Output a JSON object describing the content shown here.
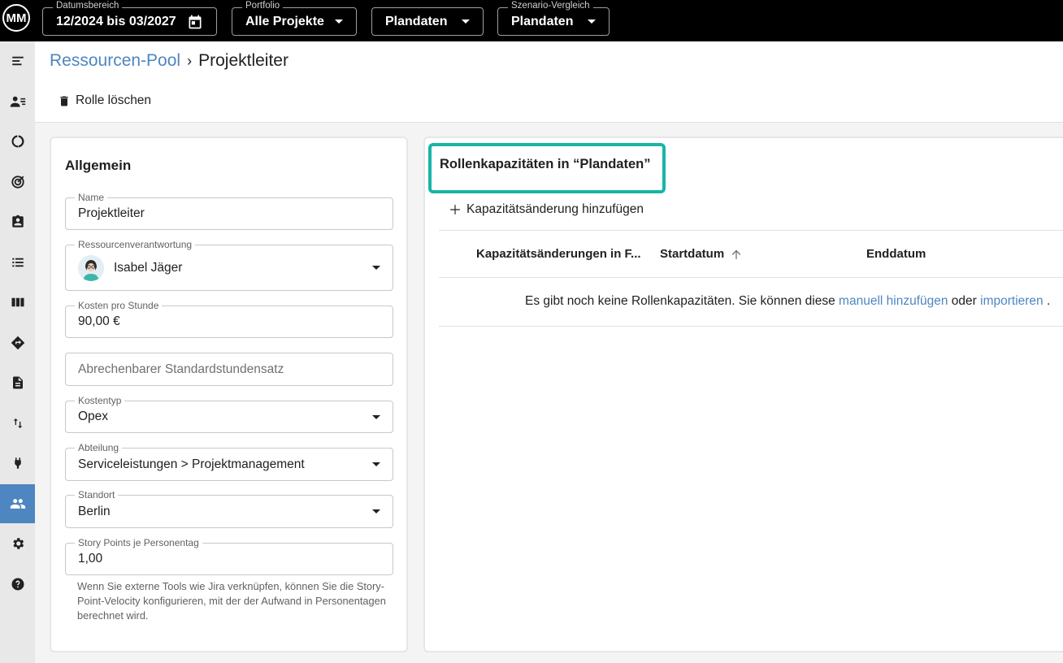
{
  "topbar": {
    "logo_text": "MM",
    "filters": [
      {
        "label": "Datumsbereich",
        "value": "12/2024 bis 03/2027",
        "icon": "calendar-icon"
      },
      {
        "label": "Portfolio",
        "value": "Alle Projekte"
      },
      {
        "label": "",
        "value": "Plandaten"
      },
      {
        "label": "Szenario-Vergleich",
        "value": "Plandaten"
      }
    ]
  },
  "sidebar": {
    "items": [
      "menu-icon",
      "resource-list-icon",
      "donut-chart-icon",
      "target-icon",
      "clipboard-person-icon",
      "list-icon",
      "columns-icon",
      "roadmap-icon",
      "document-icon",
      "import-export-icon",
      "plug-icon",
      "people-icon",
      "gear-icon",
      "help-icon"
    ],
    "active_index": 11
  },
  "header": {
    "breadcrumb_root": "Ressourcen-Pool",
    "breadcrumb_separator": "›",
    "breadcrumb_current": "Projektleiter",
    "delete_label": "Rolle löschen"
  },
  "general": {
    "title": "Allgemein",
    "name_label": "Name",
    "name_value": "Projektleiter",
    "owner_label": "Ressourcenverantwortung",
    "owner_value": "Isabel Jäger",
    "cost_label": "Kosten pro Stunde",
    "cost_value": "90,00 €",
    "billable_placeholder": "Abrechenbarer Standardstundensatz",
    "cost_type_label": "Kostentyp",
    "cost_type_value": "Opex",
    "department_label": "Abteilung",
    "department_value": "Serviceleistungen > Projektmanagement",
    "location_label": "Standort",
    "location_value": "Berlin",
    "story_points_label": "Story Points je Personentag",
    "story_points_value": "1,00",
    "hint": "Wenn Sie externe Tools wie Jira verknüpfen, können Sie die Story-Point-Velocity konfigurieren, mit der der Aufwand in Personentagen berechnet wird."
  },
  "capacities": {
    "title": "Rollenkapazitäten in “Plandaten”",
    "highlight_color": "#18b5a6",
    "add_label": "Kapazitätsänderung hinzufügen",
    "columns": [
      "Kapazitätsänderungen in F...",
      "Startdatum",
      "Enddatum"
    ],
    "empty_prefix": "Es gibt noch keine Rollenkapazitäten. Sie können diese",
    "empty_link1": "manuell hinzufügen",
    "empty_mid": "oder",
    "empty_link2": "importieren",
    "empty_suffix": "."
  },
  "colors": {
    "accent": "#4e86c1",
    "topbar": "#000000",
    "sidebar": "#e8e8e8"
  }
}
